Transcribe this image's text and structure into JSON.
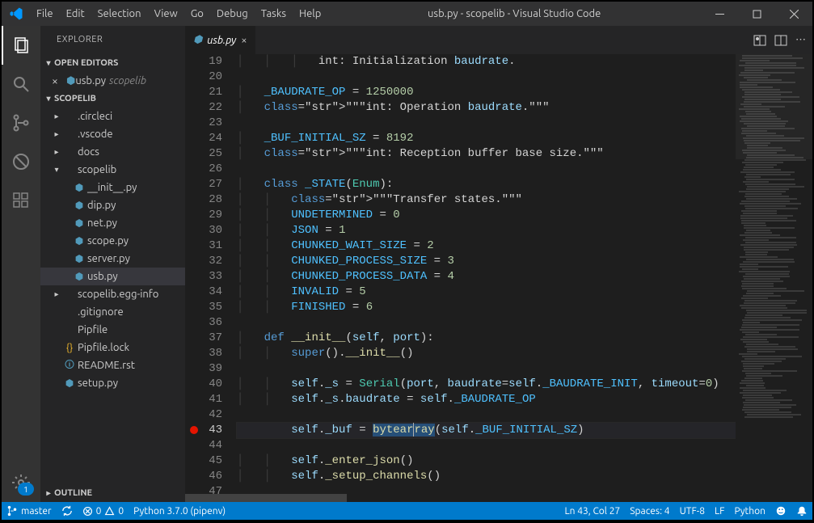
{
  "window": {
    "title": "usb.py - scopelib - Visual Studio Code"
  },
  "menu": [
    "File",
    "Edit",
    "Selection",
    "View",
    "Go",
    "Debug",
    "Tasks",
    "Help"
  ],
  "explorer": {
    "title": "EXPLORER",
    "openEditors": "OPEN EDITORS",
    "openFile": {
      "name": "usb.py",
      "project": "scopelib"
    },
    "project": "SCOPELIB",
    "tree": [
      {
        "type": "folder",
        "name": ".circleci",
        "depth": 1
      },
      {
        "type": "folder",
        "name": ".vscode",
        "depth": 1
      },
      {
        "type": "folder",
        "name": "docs",
        "depth": 1
      },
      {
        "type": "folder",
        "name": "scopelib",
        "depth": 1,
        "open": true
      },
      {
        "type": "py",
        "name": "__init__.py",
        "depth": 2
      },
      {
        "type": "py",
        "name": "dip.py",
        "depth": 2
      },
      {
        "type": "py",
        "name": "net.py",
        "depth": 2
      },
      {
        "type": "py",
        "name": "scope.py",
        "depth": 2
      },
      {
        "type": "py",
        "name": "server.py",
        "depth": 2
      },
      {
        "type": "py",
        "name": "usb.py",
        "depth": 2,
        "active": true
      },
      {
        "type": "folder",
        "name": "scopelib.egg-info",
        "depth": 1
      },
      {
        "type": "file",
        "name": ".gitignore",
        "depth": 1
      },
      {
        "type": "file",
        "name": "Pipfile",
        "depth": 1
      },
      {
        "type": "json",
        "name": "Pipfile.lock",
        "depth": 1
      },
      {
        "type": "rst",
        "name": "README.rst",
        "depth": 1
      },
      {
        "type": "py",
        "name": "setup.py",
        "depth": 1
      }
    ],
    "outline": "OUTLINE"
  },
  "tab": {
    "name": "usb.py"
  },
  "code": {
    "start": 19,
    "lines": [
      "            int: Initialization baudrate.",
      "",
      "    _BAUDRATE_OP = 1250000",
      "    \"\"\"int: Operation baudrate.\"\"\"",
      "",
      "    _BUF_INITIAL_SZ = 8192",
      "    \"\"\"int: Reception buffer base size.\"\"\"",
      "",
      "    class _STATE(Enum):",
      "        \"\"\"Transfer states.\"\"\"",
      "        UNDETERMINED = 0",
      "        JSON = 1",
      "        CHUNKED_WAIT_SIZE = 2",
      "        CHUNKED_PROCESS_SIZE = 3",
      "        CHUNKED_PROCESS_DATA = 4",
      "        INVALID = 5",
      "        FINISHED = 6",
      "",
      "    def __init__(self, port):",
      "        super().__init__()",
      "",
      "        self._s = Serial(port, baudrate=self._BAUDRATE_INIT, timeout=0)",
      "        self._s.baudrate = self._BAUDRATE_OP",
      "",
      "        self._buf = bytearray(self._BUF_INITIAL_SZ)",
      "",
      "        self._enter_json()",
      "        self._setup_channels()",
      ""
    ],
    "breakpoint": 43,
    "cursorLine": 43
  },
  "status": {
    "branch": "master",
    "errors": "0",
    "warnings": "0",
    "python": "Python 3.7.0 (pipenv)",
    "pos": "Ln 43, Col 27",
    "spaces": "Spaces: 4",
    "enc": "UTF-8",
    "eol": "LF",
    "lang": "Python"
  }
}
